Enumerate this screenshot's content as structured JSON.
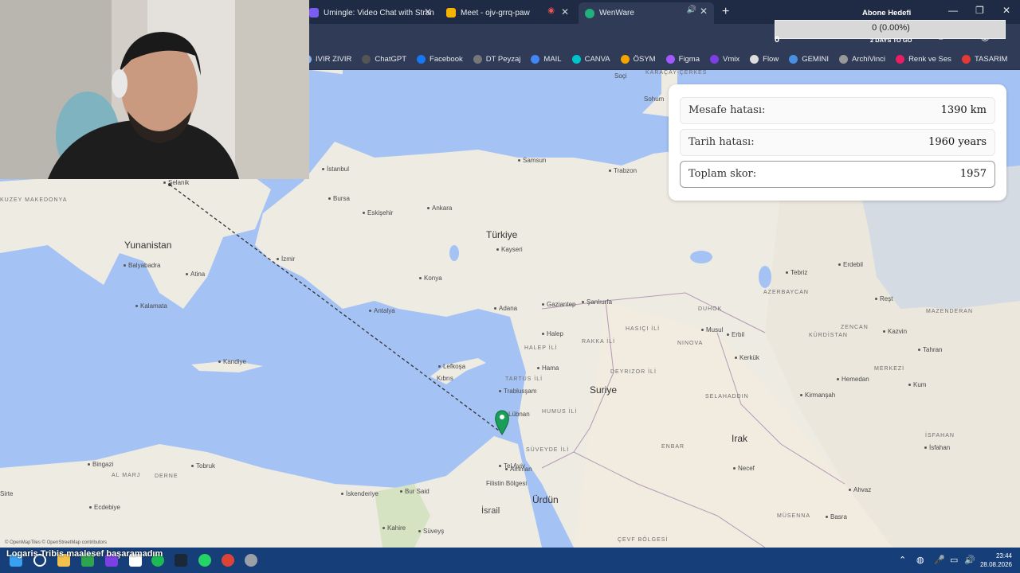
{
  "tabs": [
    {
      "title": "Umingle: Video Chat with Stran",
      "icon_color": "#7b5cf0"
    },
    {
      "title": "Meet - ojv-grrq-paw",
      "icon_color": "#f4b400"
    },
    {
      "title": "WenWare",
      "icon_color": "#22b07d"
    }
  ],
  "bookmarks": [
    {
      "label": "IVIR ZIVIR",
      "icon": "folder-icon",
      "color": "#8ab4f8"
    },
    {
      "label": "ChatGPT",
      "icon": "chatgpt-icon",
      "color": "#555"
    },
    {
      "label": "Facebook",
      "icon": "facebook-icon",
      "color": "#1877f2"
    },
    {
      "label": "DT Peyzaj",
      "icon": "page-icon",
      "color": "#777"
    },
    {
      "label": "MAIL",
      "icon": "mail-icon",
      "color": "#4285f4"
    },
    {
      "label": "CANVA",
      "icon": "canva-icon",
      "color": "#00c4cc"
    },
    {
      "label": "ÖSYM",
      "icon": "osym-icon",
      "color": "#f4a300"
    },
    {
      "label": "Figma",
      "icon": "figma-icon",
      "color": "#a259ff"
    },
    {
      "label": "Vmix",
      "icon": "vmix-icon",
      "color": "#7b3fe4"
    },
    {
      "label": "Flow",
      "icon": "flow-icon",
      "color": "#ddd"
    },
    {
      "label": "GEMINI",
      "icon": "gemini-icon",
      "color": "#4a90e2"
    },
    {
      "label": "ArchiVinci",
      "icon": "archivinci-icon",
      "color": "#999"
    },
    {
      "label": "Renk ve Ses",
      "icon": "renk-icon",
      "color": "#e91e63"
    },
    {
      "label": "TASARIM",
      "icon": "tasarim-icon",
      "color": "#e53935"
    }
  ],
  "abone": {
    "title": "Abone Hedefi",
    "value": "0 (0.00%)",
    "start": "0",
    "days": "2 DAYS TO GO"
  },
  "score": {
    "distance_label": "Mesafe hatası:",
    "distance_value": "1390 km",
    "date_label": "Tarih hatası:",
    "date_value": "1960 years",
    "total_label": "Toplam skor:",
    "total_value": "1957"
  },
  "map": {
    "countries": [
      "Türkiye",
      "Yunanistan",
      "Suriye",
      "Irak",
      "Ürdün",
      "Kıbrıs",
      "Lübnan",
      "İsrail"
    ],
    "cities": [
      "İstanbul",
      "Ankara",
      "Bursa",
      "Eskişehir",
      "Samsun",
      "Trabzon",
      "Kayseri",
      "Konya",
      "Antalya",
      "Adana",
      "Gaziantep",
      "Şanlıurfa",
      "İzmir",
      "Atina",
      "Selanik",
      "Halep",
      "Hama",
      "Kandiye",
      "Lefkoşa",
      "Trablusşam",
      "Tel Aviv",
      "Amman",
      "Filistin Bölgesi",
      "Bur Said",
      "İskenderiye",
      "Kahire",
      "Süveyş",
      "Bingazi",
      "Tobruk",
      "Ecdebiye",
      "Sirte",
      "Musul",
      "Erbil",
      "Kerkük",
      "Necef",
      "Tebriz",
      "Erdebil",
      "Reşt",
      "Kazvin",
      "Tahran",
      "Hemedan",
      "Kum",
      "İsfahan",
      "Ahvaz",
      "Basra",
      "Soçi",
      "Sohum",
      "Balyabadra",
      "Kalamata",
      "Kirmanşah"
    ],
    "regions": [
      "KARAÇAY-ÇERKES",
      "HASIÇI İLİ",
      "RAKKA İLİ",
      "NINOVA",
      "DEYRIZOR İLİ",
      "ENBAR",
      "MÜSENNA",
      "ÇEVF BÖLGESİ",
      "AZERBAYCAN",
      "KÜRDİSTAN",
      "ZENCAN",
      "MAZENDERAN",
      "MERKEZİ",
      "İSFAHAN",
      "HALEP İLİ",
      "HUMUS İLİ",
      "TARTUS İLİ",
      "SÜVEYDE İLİ",
      "KUZEY MAKEDONYA",
      "DERNE",
      "AL MARJ",
      "SELAHADDIN",
      "DUHOK"
    ],
    "attribution": "© OpenMapTiles © OpenStreetMap contributors"
  },
  "chat": {
    "user": "Logaris Tribis",
    "message": "maalesef başaramadım"
  },
  "clock": {
    "time": "23:44",
    "date": "28.08.2026"
  }
}
